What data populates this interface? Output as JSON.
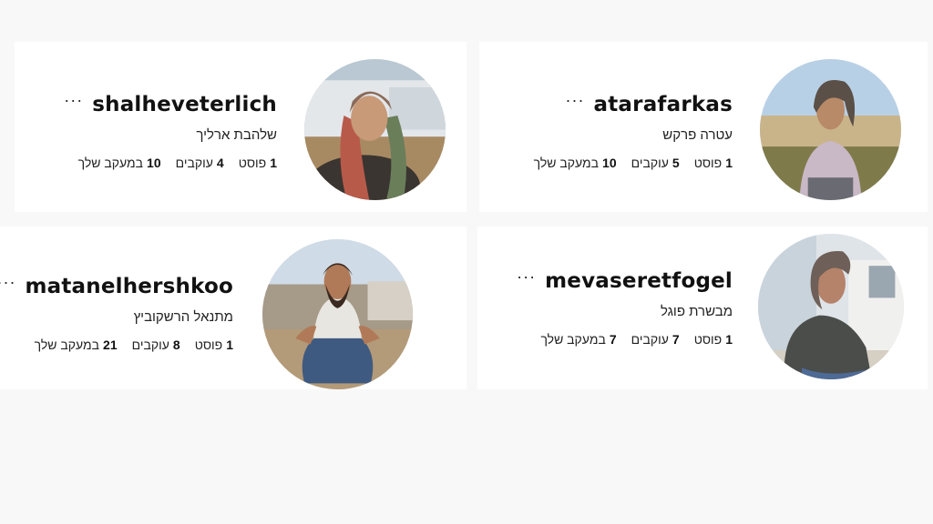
{
  "profiles": [
    {
      "username": "shalheveterlich",
      "full_name": "שלהבת ארליך",
      "posts_count": "1",
      "posts_label": "פוסט",
      "followers_count": "4",
      "followers_label": "עוקבים",
      "following_count": "10",
      "following_label": "במעקב שלך",
      "more_label": "···"
    },
    {
      "username": "atarafarkas",
      "full_name": "עטרה פרקש",
      "posts_count": "1",
      "posts_label": "פוסט",
      "followers_count": "5",
      "followers_label": "עוקבים",
      "following_count": "10",
      "following_label": "במעקב שלך",
      "more_label": "···"
    },
    {
      "username": "matanelhershkoo",
      "full_name": "מתנאל הרשקוביץ",
      "posts_count": "1",
      "posts_label": "פוסט",
      "followers_count": "8",
      "followers_label": "עוקבים",
      "following_count": "21",
      "following_label": "במעקב שלך",
      "more_label": "···"
    },
    {
      "username": "mevaseretfogel",
      "full_name": "מבשרת פוגל",
      "posts_count": "1",
      "posts_label": "פוסט",
      "followers_count": "7",
      "followers_label": "עוקבים",
      "following_count": "7",
      "following_label": "במעקב שלך",
      "more_label": "···"
    }
  ],
  "colors": {
    "page_bg": "#f8f8f8",
    "card_bg": "#ffffff",
    "text": "#111111"
  }
}
